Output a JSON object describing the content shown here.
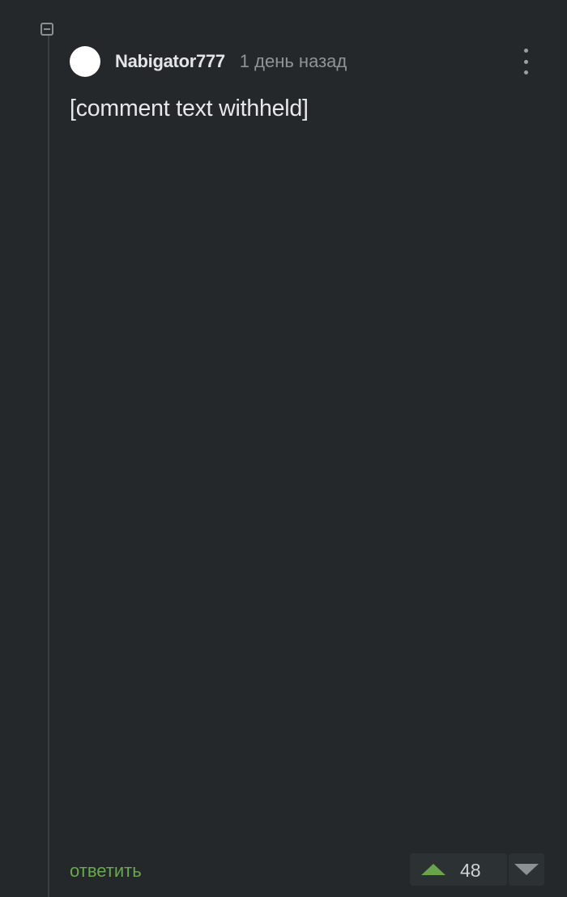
{
  "comment": {
    "author": "Nabigator777",
    "timestamp": "1 день назад",
    "text": "[comment text withheld]",
    "reply_label": "ответить",
    "score": "48"
  },
  "icons": {
    "collapse": "collapse-icon",
    "more": "more-vertical-icon",
    "upvote": "triangle-up-icon",
    "downvote": "triangle-down-icon"
  },
  "colors": {
    "background": "#24282b",
    "text": "#e6e8e9",
    "accent_green": "#6aa84f",
    "muted": "#8f9498"
  }
}
